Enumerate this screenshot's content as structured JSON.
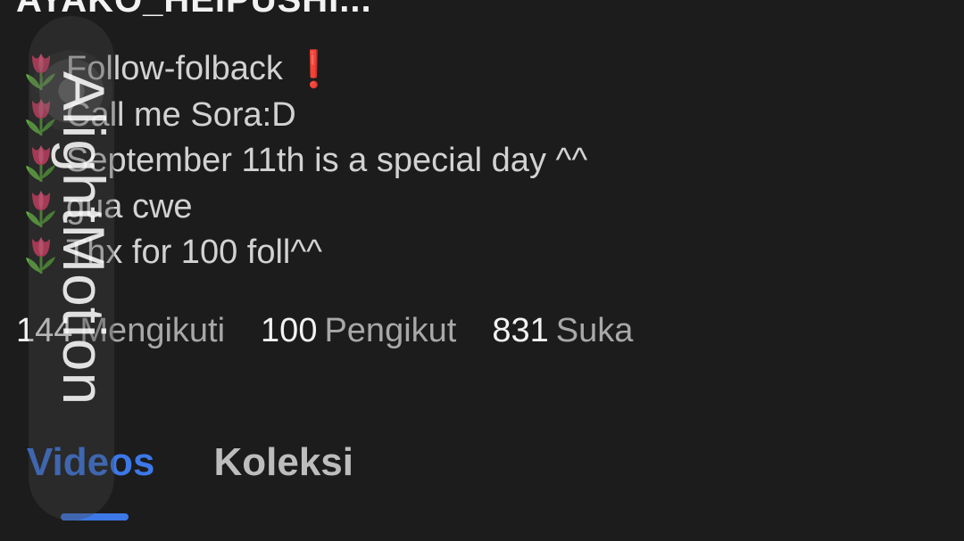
{
  "profile": {
    "username": "AYAKO_HEIPUSHI...",
    "bio": [
      {
        "icon": "tulip-icon",
        "text": "Follow-folback",
        "emoji_after": "❗"
      },
      {
        "icon": "tulip-icon",
        "text": "Call me Sora:D"
      },
      {
        "icon": "tulip-icon",
        "text": "September 11th is a special day ^^"
      },
      {
        "icon": "tulip-icon",
        "text": "gua cwe"
      },
      {
        "icon": "tulip-icon",
        "text": "Thx for 100 foll^^"
      }
    ],
    "stats": {
      "following": {
        "value": "144",
        "label": "Mengikuti"
      },
      "followers": {
        "value": "100",
        "label": "Pengikut"
      },
      "likes": {
        "value": "831",
        "label": "Suka"
      }
    }
  },
  "tabs": [
    {
      "label": "Videos",
      "active": true
    },
    {
      "label": "Koleksi",
      "active": false
    }
  ],
  "watermark": {
    "text": "AlightMotion"
  },
  "colors": {
    "background": "#1c1c1c",
    "accent": "#3c78e8",
    "exclamation": "#e31b23"
  }
}
